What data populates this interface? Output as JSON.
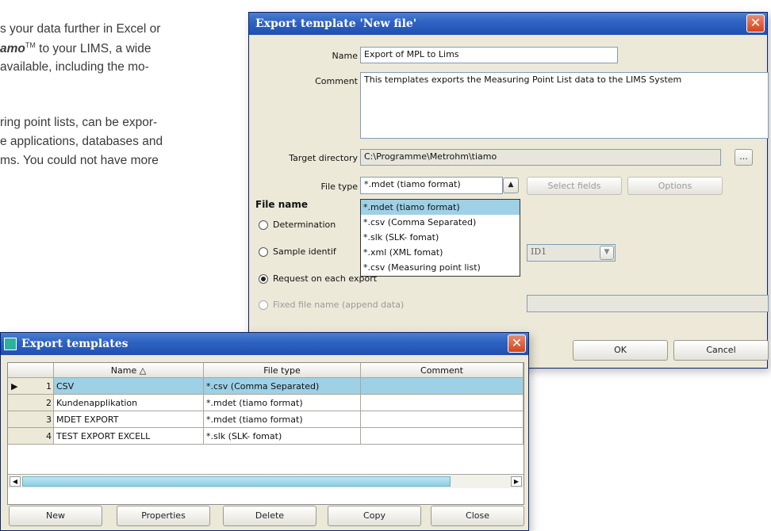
{
  "doc": {
    "line1": "s your data further in Excel or",
    "line2_bold": "amo",
    "line2_tm": "TM",
    "line2_rest": " to your LIMS, a wide",
    "line3": " available, including the mo-",
    "line4": "ring point lists, can be expor-",
    "line5": "e applications, databases and",
    "line6": "ms. You could not have more"
  },
  "export_dialog": {
    "title": "Export template 'New file'",
    "name_label": "Name",
    "name_value": "Export of MPL to Lims",
    "comment_label": "Comment",
    "comment_value": "This templates exports the Measuring Point List data to the LIMS System",
    "target_dir_label": "Target directory",
    "target_dir_value": "C:\\Programme\\Metrohm\\tiamo",
    "browse_label": "...",
    "file_type_label": "File type",
    "file_type_value": "*.mdet (tiamo format)",
    "select_fields_label": "Select fields",
    "options_label": "Options",
    "file_name_heading": "File name",
    "radio_determination": "Determination",
    "radio_sample": "Sample identif",
    "radio_request": "Request on each export",
    "radio_fixed": "Fixed file name (append data)",
    "id_value": "ID1",
    "dropdown_options": [
      "*.mdet (tiamo format)",
      "*.csv (Comma Separated)",
      "*.slk (SLK- fomat)",
      "*.xml (XML fomat)",
      "*.csv (Measuring point list)"
    ],
    "ok_label": "OK",
    "cancel_label": "Cancel"
  },
  "templates_window": {
    "title": "Export templates",
    "columns": [
      "Name",
      "File type",
      "Comment"
    ],
    "rows": [
      {
        "num": "1",
        "name": "CSV",
        "file_type": "*.csv (Comma Separated)",
        "comment": ""
      },
      {
        "num": "2",
        "name": "Kundenapplikation",
        "file_type": "*.mdet (tiamo format)",
        "comment": ""
      },
      {
        "num": "3",
        "name": "MDET EXPORT",
        "file_type": "*.mdet (tiamo format)",
        "comment": ""
      },
      {
        "num": "4",
        "name": "TEST EXPORT EXCELL",
        "file_type": "*.slk (SLK- fomat)",
        "comment": ""
      }
    ],
    "buttons": {
      "new": "New",
      "properties": "Properties",
      "delete": "Delete",
      "copy": "Copy",
      "close": "Close"
    }
  },
  "colors": {
    "titlebar": "#2f64c3",
    "selection": "#9ed0e6",
    "window_bg": "#ece9d8"
  }
}
